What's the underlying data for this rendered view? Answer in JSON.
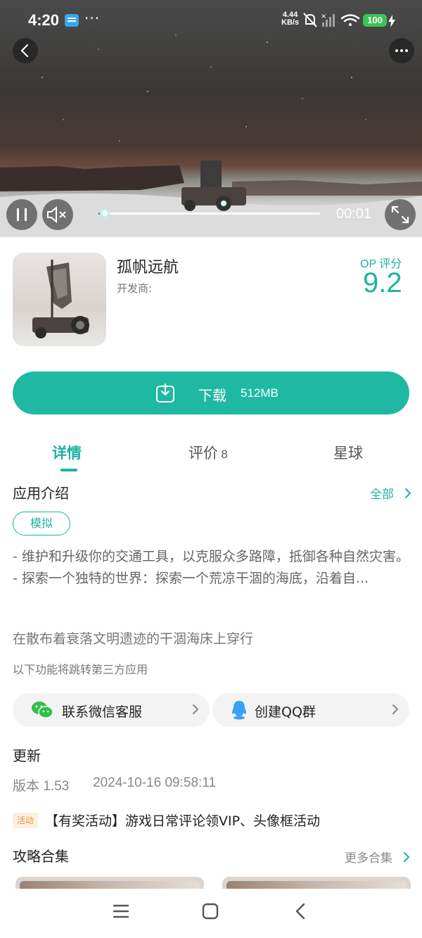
{
  "status_bar": {
    "time": "4:20",
    "overflow": "···",
    "net_speed_value": "4.44",
    "net_speed_unit": "KB/s",
    "battery": "100",
    "icons": [
      "mail-app-icon",
      "mute-bell-icon",
      "signal-off-icon",
      "wifi-icon",
      "battery-icon",
      "charging-icon"
    ]
  },
  "video": {
    "current_time": "00:01",
    "progress": 0.03
  },
  "app": {
    "name": "孤帆远航",
    "developer_label": "开发商:",
    "score_label": "OP 评分",
    "score": "9.2"
  },
  "download": {
    "label": "下载",
    "size": "512MB"
  },
  "tabs": [
    {
      "label": "详情",
      "active": true
    },
    {
      "label": "评价",
      "count": "8"
    },
    {
      "label": "星球"
    }
  ],
  "intro": {
    "title": "应用介绍",
    "all_link": "全部",
    "tag": "模拟",
    "description_line1": "- 维护和升级你的交通工具，以克服众多路障，抵御各种自然灾害。",
    "description_line2": "- 探索一个独特的世界：探索一个荒凉干涸的海底，沿着自...",
    "tagline": "在散布着衰落文明遗迹的干涸海床上穿行",
    "third_party_note": "以下功能将跳转第三方应用"
  },
  "contact": {
    "wechat": "联系微信客服",
    "qq": "创建QQ群"
  },
  "update": {
    "title": "更新",
    "version": "版本 1.53",
    "date": "2024-10-16 09:58:11",
    "event_tag": "活动",
    "event_text": "【有奖活动】游戏日常评论领VIP、头像框活动"
  },
  "guides": {
    "title": "攻略合集",
    "more": "更多合集"
  },
  "colors": {
    "accent": "#1db3a1",
    "battery": "#3cc254",
    "event_tag": "#e69440"
  }
}
